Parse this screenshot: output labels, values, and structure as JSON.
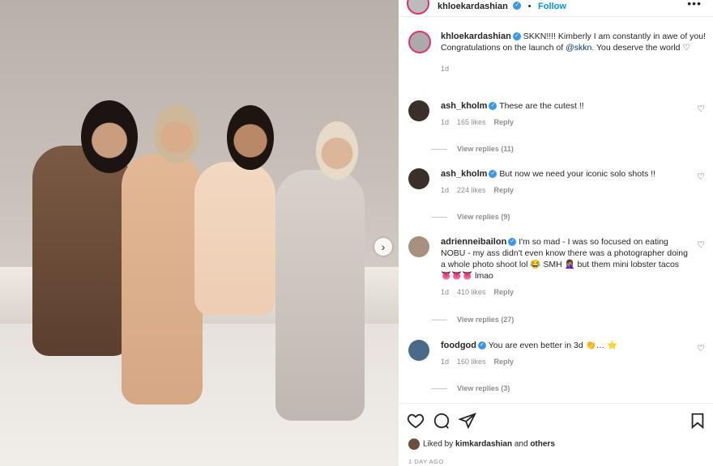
{
  "post": {
    "author": "khloekardashian",
    "follow_label": "Follow",
    "more_icon": "more-horizontal-icon",
    "caption": {
      "username": "khloekardashian",
      "text_before": "SKKN!!!! Kimberly I am constantly in awe of you! Congratulations on the launch of ",
      "mention": "@skkn",
      "text_after": ". You deserve the world ♡",
      "time": "1d"
    }
  },
  "comments": [
    {
      "username": "ash_kholm",
      "text": "These are the cutest !!",
      "time": "1d",
      "likes": "165 likes",
      "reply": "Reply",
      "view_replies": "View replies (11)"
    },
    {
      "username": "ash_kholm",
      "text": "But now we need your iconic solo shots !!",
      "time": "1d",
      "likes": "224 likes",
      "reply": "Reply",
      "view_replies": "View replies (9)"
    },
    {
      "username": "adrienneibailon",
      "text": "I'm so mad - I was so focused on eating NOBU - my ass didn't even know there was a photographer doing a whole photo shoot lol 😂 SMH 🤦🏽‍♀️ but them mini lobster tacos 👅👅👅 lmao",
      "time": "1d",
      "likes": "410 likes",
      "reply": "Reply",
      "view_replies": "View replies (27)"
    },
    {
      "username": "foodgod",
      "text": "You are even better in 3d 👏… ⭐",
      "time": "1d",
      "likes": "160 likes",
      "reply": "Reply",
      "view_replies": "View replies (3)"
    }
  ],
  "footer": {
    "liked_prefix": "Liked by ",
    "liked_user": "kimkardashian",
    "liked_mid": " and ",
    "liked_others": "others",
    "timestamp": "1 DAY AGO"
  },
  "icons": {
    "heart": "heart-icon",
    "comment": "comment-icon",
    "share": "share-icon",
    "save": "bookmark-icon",
    "next": "chevron-right-icon"
  },
  "colors": {
    "verified": "#3897f0",
    "follow": "#0095f6",
    "mention": "#00376b",
    "muted": "#8e8e8e"
  }
}
